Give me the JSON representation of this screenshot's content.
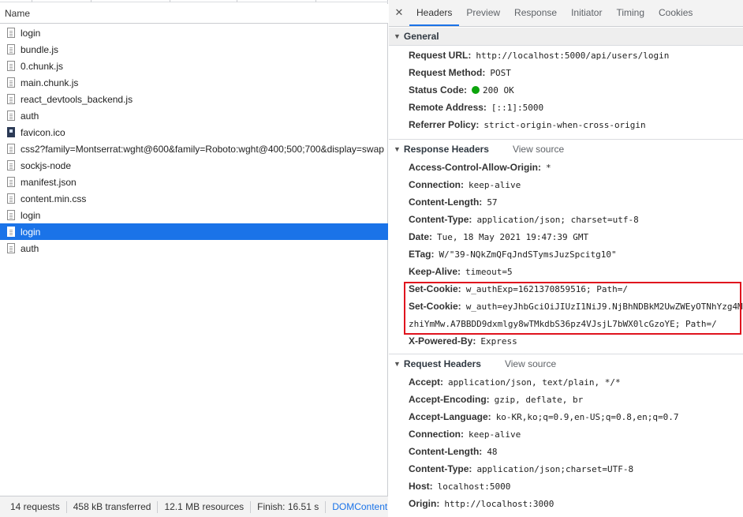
{
  "left": {
    "column_header": "Name",
    "requests": [
      {
        "name": "login",
        "icon": "document-icon",
        "selected": false
      },
      {
        "name": "bundle.js",
        "icon": "script-file-icon",
        "selected": false
      },
      {
        "name": "0.chunk.js",
        "icon": "script-file-icon",
        "selected": false
      },
      {
        "name": "main.chunk.js",
        "icon": "script-file-icon",
        "selected": false
      },
      {
        "name": "react_devtools_backend.js",
        "icon": "script-file-icon",
        "selected": false
      },
      {
        "name": "auth",
        "icon": "document-icon",
        "selected": false
      },
      {
        "name": "favicon.ico",
        "icon": "image-file-icon",
        "selected": false
      },
      {
        "name": "css2?family=Montserrat:wght@600&family=Roboto:wght@400;500;700&display=swap",
        "icon": "stylesheet-file-icon",
        "selected": false
      },
      {
        "name": "sockjs-node",
        "icon": "document-icon",
        "selected": false
      },
      {
        "name": "manifest.json",
        "icon": "script-file-icon",
        "selected": false
      },
      {
        "name": "content.min.css",
        "icon": "stylesheet-file-icon",
        "selected": false
      },
      {
        "name": "login",
        "icon": "document-icon",
        "selected": false
      },
      {
        "name": "login",
        "icon": "document-icon",
        "selected": true
      },
      {
        "name": "auth",
        "icon": "document-icon",
        "selected": false
      }
    ],
    "status": {
      "requests": "14 requests",
      "transferred": "458 kB transferred",
      "resources": "12.1 MB resources",
      "finish": "Finish: 16.51 s",
      "domcontent": "DOMContentLoaded"
    }
  },
  "right": {
    "close_symbol": "✕",
    "tabs": [
      "Headers",
      "Preview",
      "Response",
      "Initiator",
      "Timing",
      "Cookies"
    ],
    "active_tab": "Headers",
    "general": {
      "title": "General",
      "rows": [
        {
          "k": "Request URL:",
          "v": "http://localhost:5000/api/users/login"
        },
        {
          "k": "Request Method:",
          "v": "POST"
        },
        {
          "k": "Status Code:",
          "v": "200 OK"
        },
        {
          "k": "Remote Address:",
          "v": "[::1]:5000"
        },
        {
          "k": "Referrer Policy:",
          "v": "strict-origin-when-cross-origin"
        }
      ]
    },
    "response_headers": {
      "title": "Response Headers",
      "view_source": "View source",
      "rows": [
        {
          "k": "Access-Control-Allow-Origin:",
          "v": "*"
        },
        {
          "k": "Connection:",
          "v": "keep-alive"
        },
        {
          "k": "Content-Length:",
          "v": "57"
        },
        {
          "k": "Content-Type:",
          "v": "application/json; charset=utf-8"
        },
        {
          "k": "Date:",
          "v": "Tue, 18 May 2021 19:47:39 GMT"
        },
        {
          "k": "ETag:",
          "v": "W/\"39-NQkZmQFqJndSTymsJuzSpcitg10\""
        },
        {
          "k": "Keep-Alive:",
          "v": "timeout=5"
        },
        {
          "k": "Set-Cookie:",
          "v": "w_authExp=1621370859516; Path=/"
        },
        {
          "k": "Set-Cookie:",
          "v": "w_auth=eyJhbGciOiJIUzI1NiJ9.NjBhNDBkM2UwZWEyOTNhYzg4M"
        },
        {
          "k": "",
          "v": "zhiYmMw.A7BBDD9dxmlgy8wTMkdbS36pz4VJsjL7bWX0lcGzoYE; Path=/"
        },
        {
          "k": "X-Powered-By:",
          "v": "Express"
        }
      ]
    },
    "request_headers": {
      "title": "Request Headers",
      "view_source": "View source",
      "rows": [
        {
          "k": "Accept:",
          "v": "application/json, text/plain, */*"
        },
        {
          "k": "Accept-Encoding:",
          "v": "gzip, deflate, br"
        },
        {
          "k": "Accept-Language:",
          "v": "ko-KR,ko;q=0.9,en-US;q=0.8,en;q=0.7"
        },
        {
          "k": "Connection:",
          "v": "keep-alive"
        },
        {
          "k": "Content-Length:",
          "v": "48"
        },
        {
          "k": "Content-Type:",
          "v": "application/json;charset=UTF-8"
        },
        {
          "k": "Host:",
          "v": "localhost:5000"
        },
        {
          "k": "Origin:",
          "v": "http://localhost:3000"
        }
      ]
    }
  },
  "colors": {
    "selected_row": "#1a73e8",
    "status_ok": "#0ca40c",
    "highlight_box": "#e0141e",
    "link": "#1a73e8"
  }
}
